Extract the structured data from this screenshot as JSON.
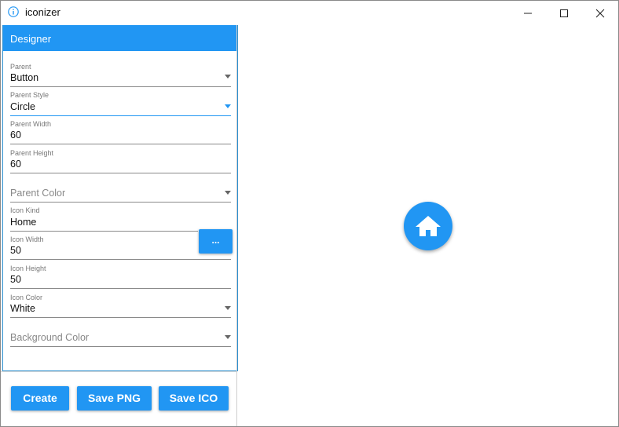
{
  "window": {
    "title": "iconizer"
  },
  "panel": {
    "header": "Designer"
  },
  "fields": {
    "parent": {
      "label": "Parent",
      "value": "Button"
    },
    "parent_style": {
      "label": "Parent Style",
      "value": "Circle"
    },
    "parent_width": {
      "label": "Parent Width",
      "value": "60"
    },
    "parent_height": {
      "label": "Parent Height",
      "value": "60"
    },
    "parent_color": {
      "placeholder": "Parent Color"
    },
    "icon_kind": {
      "label": "Icon Kind",
      "value": "Home",
      "button_label": "..."
    },
    "icon_width": {
      "label": "Icon Width",
      "value": "50"
    },
    "icon_height": {
      "label": "Icon Height",
      "value": "50"
    },
    "icon_color": {
      "label": "Icon Color",
      "value": "White"
    },
    "background_color": {
      "placeholder": "Background Color"
    }
  },
  "actions": {
    "create": "Create",
    "save_png": "Save PNG",
    "save_ico": "Save ICO"
  },
  "preview": {
    "icon": "home-icon",
    "shape": "circle"
  },
  "colors": {
    "accent": "#2196F3",
    "icon": "#FFFFFF"
  }
}
